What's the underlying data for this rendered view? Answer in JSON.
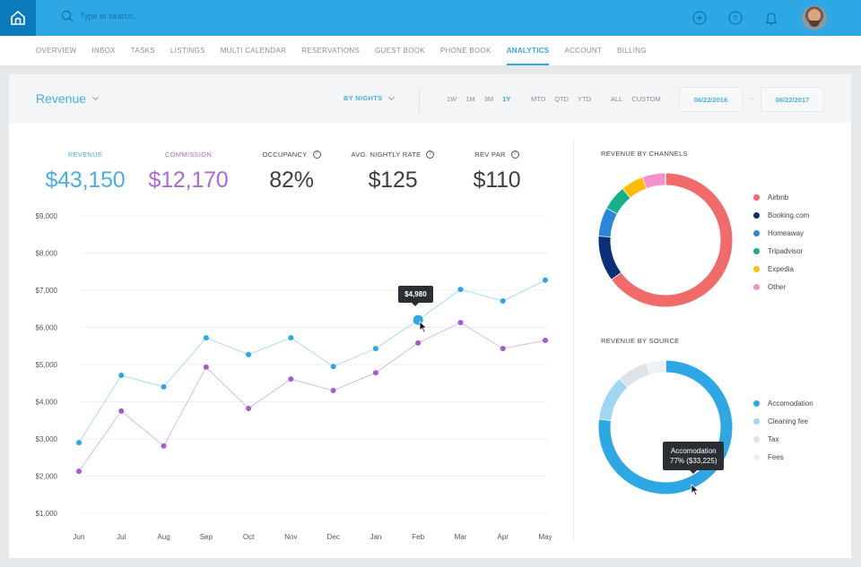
{
  "topbar": {
    "logo_icon": "home-icon",
    "search_placeholder": "Type to search...",
    "icons": [
      "plus-circle-icon",
      "help-circle-icon",
      "bell-icon"
    ]
  },
  "nav": {
    "items": [
      "Overview",
      "Inbox",
      "Tasks",
      "Listings",
      "Multi Calendar",
      "Reservations",
      "Guest Book",
      "Phone Book",
      "Analytics",
      "Account",
      "Billing"
    ],
    "active": "Analytics"
  },
  "header": {
    "title": "Revenue",
    "by_nights": "BY NIGHTS",
    "ranges_a": [
      "1W",
      "1M",
      "3M",
      "1Y"
    ],
    "ranges_b": [
      "MTD",
      "QTD",
      "YTD"
    ],
    "ranges_c": [
      "ALL",
      "CUSTOM"
    ],
    "active_range": "1Y",
    "date_from": "06/22/2016",
    "date_to": "06/22/2017"
  },
  "kpis": {
    "revenue": {
      "label": "REVENUE",
      "value": "$43,150"
    },
    "commission": {
      "label": "COMMISSION",
      "value": "$12,170"
    },
    "occupancy": {
      "label": "OCCUPANCY",
      "value": "82%"
    },
    "avg_rate": {
      "label": "AVG. NIGHTLY RATE",
      "value": "$125"
    },
    "revpar": {
      "label": "REV PAR",
      "value": "$110"
    }
  },
  "colors": {
    "brand": "#2ea8e5",
    "revenue": "#2ea8e5",
    "revenue_line": "#a9dcf5",
    "commission": "#a35bd0",
    "commission_line": "#d9b8ee"
  },
  "line_tooltip": "$4,980",
  "source_tooltip": {
    "title": "Accomodation",
    "detail": "77% ($33,225)"
  },
  "chart_data": [
    {
      "type": "line",
      "title": "Revenue",
      "categories": [
        "Jun",
        "Jul",
        "Aug",
        "Sep",
        "Oct",
        "Nov",
        "Dec",
        "Jan",
        "Feb",
        "Mar",
        "Apr",
        "May"
      ],
      "series": [
        {
          "name": "Revenue",
          "color": "#2ea8e5",
          "values": [
            2900,
            4710,
            4400,
            5720,
            5270,
            5720,
            4950,
            5430,
            6200,
            7020,
            6710,
            7270
          ]
        },
        {
          "name": "Commission",
          "color": "#a35bd0",
          "values": [
            2130,
            3750,
            2810,
            4930,
            3820,
            4610,
            4300,
            4780,
            5580,
            6130,
            5430,
            5650
          ]
        }
      ],
      "yticks": [
        "$9,000",
        "$8,000",
        "$7,000",
        "$6,000",
        "$5,000",
        "$4,000",
        "$3,000",
        "$2,000",
        "$1,000"
      ],
      "ylim": [
        1000,
        9000
      ],
      "grid": true,
      "highlight": {
        "series": "Revenue",
        "category": "Feb",
        "label": "$4,980"
      }
    },
    {
      "type": "pie",
      "title": "REVENUE BY CHANNELS",
      "donut": true,
      "slices": [
        {
          "label": "Airbnb",
          "value": 65,
          "color": "#f26b6b"
        },
        {
          "label": "Booking.com",
          "value": 11,
          "color": "#0c2f7a"
        },
        {
          "label": "Homeaway",
          "value": 7,
          "color": "#2e86d8"
        },
        {
          "label": "Tripadvisor",
          "value": 6,
          "color": "#15b08a"
        },
        {
          "label": "Expedia",
          "value": 5.5,
          "color": "#ffbd0a"
        },
        {
          "label": "Other",
          "value": 5.5,
          "color": "#f58fce"
        }
      ],
      "legend": "right"
    },
    {
      "type": "pie",
      "title": "REVENUE BY SOURCE",
      "donut": true,
      "slices": [
        {
          "label": "Accomodation",
          "value": 77,
          "color": "#2ea8e5"
        },
        {
          "label": "Cleaning fee",
          "value": 11,
          "color": "#9fd6f3"
        },
        {
          "label": "Tax",
          "value": 7.5,
          "color": "#dde3e7"
        },
        {
          "label": "Fees",
          "value": 4.5,
          "color": "#eef1f3"
        }
      ],
      "legend": "right"
    }
  ]
}
